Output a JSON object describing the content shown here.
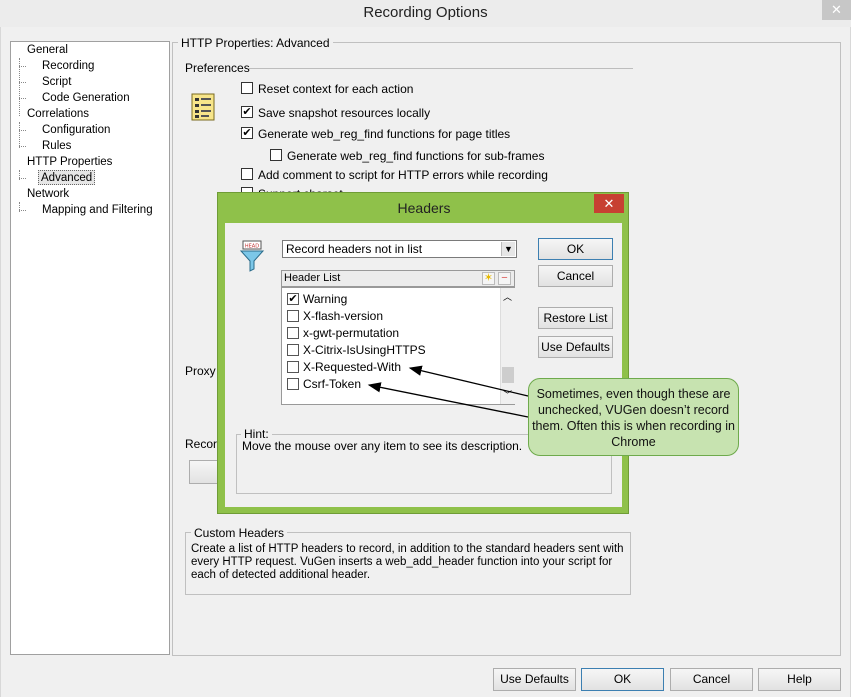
{
  "window": {
    "title": "Recording Options",
    "close_glyph": "✕"
  },
  "tree": {
    "items": [
      {
        "label": "General"
      },
      {
        "label": "Recording"
      },
      {
        "label": "Script"
      },
      {
        "label": "Code Generation"
      },
      {
        "label": "Correlations"
      },
      {
        "label": "Configuration"
      },
      {
        "label": "Rules"
      },
      {
        "label": "HTTP Properties"
      },
      {
        "label": "Advanced",
        "selected": true
      },
      {
        "label": "Network"
      },
      {
        "label": "Mapping and Filtering"
      }
    ]
  },
  "panel": {
    "group_title": "HTTP Properties: Advanced",
    "preferences_label": "Preferences",
    "icon": "settings-list-icon",
    "options": [
      {
        "label": "Reset context for each action",
        "checked": false
      },
      {
        "label": "Save snapshot resources locally",
        "checked": true
      },
      {
        "label": "Generate web_reg_find functions for page titles",
        "checked": true
      },
      {
        "label": "Generate web_reg_find functions for sub-frames",
        "checked": false
      },
      {
        "label": "Add comment to script for HTTP errors while recording",
        "checked": false
      },
      {
        "label": "Support charset",
        "checked": false
      }
    ],
    "proxy_label": "Proxy r",
    "record_label": "Record",
    "custom_headers": {
      "title": "Custom Headers",
      "text": "Create a list of HTTP headers to record, in addition to the standard headers sent with every HTTP request. VuGen inserts a web_add_header function into your script for each of detected additional header."
    }
  },
  "footer": {
    "use_defaults": "Use Defaults",
    "ok": "OK",
    "cancel": "Cancel",
    "help": "Help"
  },
  "headers_dialog": {
    "title": "Headers",
    "close_glyph": "✕",
    "icon": "header-filter-icon",
    "mode_select": "Record headers not in list",
    "list_header": "Header List",
    "items": [
      {
        "label": "Warning",
        "checked": true
      },
      {
        "label": "X-flash-version",
        "checked": false
      },
      {
        "label": "x-gwt-permutation",
        "checked": false
      },
      {
        "label": "X-Citrix-IsUsingHTTPS",
        "checked": false
      },
      {
        "label": "X-Requested-With",
        "checked": false
      },
      {
        "label": "Csrf-Token",
        "checked": false
      }
    ],
    "ok": "OK",
    "cancel": "Cancel",
    "restore_list": "Restore List",
    "use_defaults": "Use Defaults",
    "hint_title": "Hint:",
    "hint_text": "Move the mouse over any item to see its description."
  },
  "callout": {
    "text": "Sometimes, even though these are unchecked, VUGen doesn’t record them. Often this is when recording in Chrome",
    "color": "#c7e3b0"
  }
}
